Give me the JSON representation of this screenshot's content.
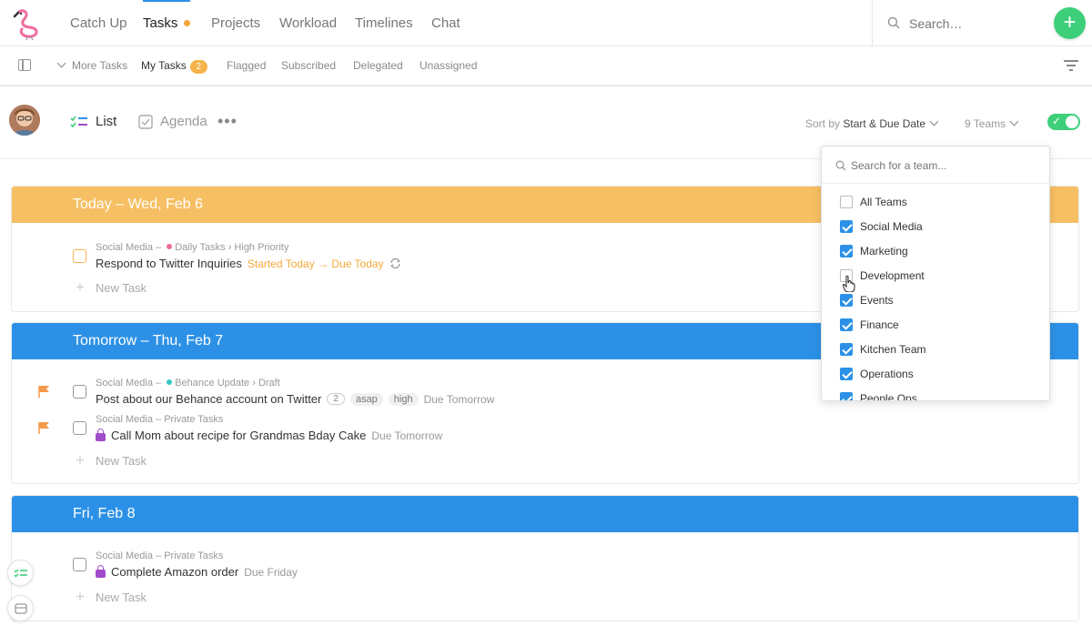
{
  "nav": {
    "items": [
      "Catch Up",
      "Tasks",
      "Projects",
      "Workload",
      "Timelines",
      "Chat"
    ],
    "active": "Tasks",
    "search_placeholder": "Search…"
  },
  "subnav": {
    "more_tasks": "More Tasks",
    "my_tasks": "My Tasks",
    "my_tasks_count": "2",
    "flagged": "Flagged",
    "subscribed": "Subscribed",
    "delegated": "Delegated",
    "unassigned": "Unassigned"
  },
  "toolbar": {
    "list": "List",
    "agenda": "Agenda",
    "more": "•••",
    "sort_prefix": "Sort by ",
    "sort_value": "Start & Due Date",
    "teams": "9 Teams"
  },
  "sections": [
    {
      "title": "Today – Wed, Feb 6",
      "tasks": [
        {
          "meta_team": "Social Media",
          "meta_sep": " – ",
          "meta_project": "Daily Tasks",
          "meta_sub": " › High Priority",
          "title": "Respond to Twitter Inquiries",
          "due": "Started Today → Due Today"
        }
      ],
      "new_task": "New Task"
    },
    {
      "title": "Tomorrow – Thu, Feb 7",
      "tasks": [
        {
          "meta_team": "Social Media",
          "meta_sep": " – ",
          "meta_project": "Behance Update",
          "meta_sub": " › Draft",
          "title": "Post about our Behance account on Twitter",
          "comments": "2",
          "tag1": "asap",
          "tag2": "high",
          "due": "Due Tomorrow"
        },
        {
          "meta_team": "Social Media",
          "meta_sub": " – Private Tasks",
          "title": "Call Mom about recipe for Grandmas Bday Cake",
          "due": "Due Tomorrow"
        }
      ],
      "new_task": "New Task"
    },
    {
      "title": "Fri, Feb 8",
      "tasks": [
        {
          "meta_team": "Social Media",
          "meta_sub": " – Private Tasks",
          "title": "Complete Amazon order",
          "due": "Due Friday"
        }
      ],
      "new_task": "New Task"
    }
  ],
  "team_dropdown": {
    "search_placeholder": "Search for a team...",
    "teams": [
      {
        "name": "All Teams",
        "checked": false
      },
      {
        "name": "Social Media",
        "checked": true
      },
      {
        "name": "Marketing",
        "checked": true
      },
      {
        "name": "Development",
        "checked": false
      },
      {
        "name": "Events",
        "checked": true
      },
      {
        "name": "Finance",
        "checked": true
      },
      {
        "name": "Kitchen Team",
        "checked": true
      },
      {
        "name": "Operations",
        "checked": true
      },
      {
        "name": "People Ops",
        "checked": true
      }
    ]
  },
  "colors": {
    "accent_blue": "#2c91e6",
    "today_orange": "#f7bf63",
    "add_green": "#3ecf7a",
    "flag_orange": "#f39a4a",
    "private_purple": "#a04cc8"
  }
}
